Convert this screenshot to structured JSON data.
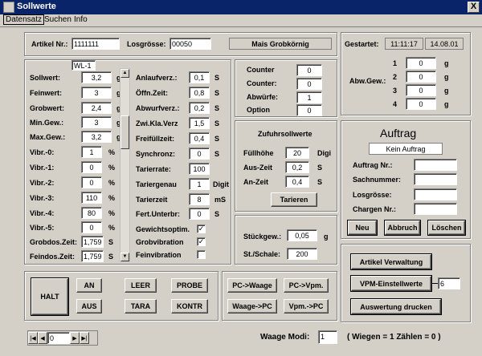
{
  "window": {
    "title": "Sollwerte",
    "close": "X"
  },
  "menu": [
    "Datensatz",
    "Suchen",
    "Info"
  ],
  "header": {
    "artikel_label": "Artikel Nr.:",
    "artikel_value": "1111111",
    "losgroesse_label": "Losgrösse:",
    "losgroesse_value": "00050",
    "product_name": "Mais Grobkörnig"
  },
  "gestartet": {
    "label": "Gestartet:",
    "time": "11:11:17",
    "date": "14.08.01"
  },
  "ausgew": {
    "label": "Abw.Gew.:",
    "rows": [
      {
        "n": "1",
        "v": "0",
        "u": "g"
      },
      {
        "n": "2",
        "v": "0",
        "u": "g"
      },
      {
        "n": "3",
        "v": "0",
        "u": "g"
      },
      {
        "n": "4",
        "v": "0",
        "u": "g"
      }
    ]
  },
  "sollwerte": {
    "tag": "WL-1",
    "left_rows": [
      {
        "label": "Sollwert:",
        "value": "3,2",
        "unit": "g"
      },
      {
        "label": "Feinwert:",
        "value": "3",
        "unit": "g"
      },
      {
        "label": "Grobwert:",
        "value": "2,4",
        "unit": "g"
      },
      {
        "label": "Min.Gew.:",
        "value": "3",
        "unit": "g"
      },
      {
        "label": "Max.Gew.:",
        "value": "3,2",
        "unit": "g"
      },
      {
        "label": "Vibr.-0:",
        "value": "1",
        "unit": "%"
      },
      {
        "label": "Vibr.-1:",
        "value": "0",
        "unit": "%"
      },
      {
        "label": "Vibr.-2:",
        "value": "0",
        "unit": "%"
      },
      {
        "label": "Vibr.-3:",
        "value": "110",
        "unit": "%"
      },
      {
        "label": "Vibr.-4:",
        "value": "80",
        "unit": "%"
      },
      {
        "label": "Vibr.-5:",
        "value": "0",
        "unit": "%"
      },
      {
        "label": "Grobdos.Zeit:",
        "value": "1,759",
        "unit": "S"
      },
      {
        "label": "Feindos.Zeit:",
        "value": "1,759",
        "unit": "S"
      }
    ],
    "right_rows": [
      {
        "label": "Anlaufverz.:",
        "value": "0,1",
        "unit": "S"
      },
      {
        "label": "Öffn.Zeit:",
        "value": "0,8",
        "unit": "S"
      },
      {
        "label": "Abwurfverz.:",
        "value": "0,2",
        "unit": "S"
      },
      {
        "label": "Zwi.Kla.Verz",
        "value": "1,5",
        "unit": "S"
      },
      {
        "label": "Freifüllzeit:",
        "value": "0,4",
        "unit": "S"
      },
      {
        "label": "Synchronz:",
        "value": "0",
        "unit": "S"
      },
      {
        "label": "Tarierrate:",
        "value": "100",
        "unit": ""
      },
      {
        "label": "Tariergenau",
        "value": "1",
        "unit": "Digit"
      },
      {
        "label": "Tarierzeit",
        "value": "8",
        "unit": "mS"
      },
      {
        "label": "Fert.Unterbr:",
        "value": "0",
        "unit": "S"
      }
    ],
    "checks": [
      {
        "label": "Gewichtsoptim.",
        "checked": "✓"
      },
      {
        "label": "Grobvibration",
        "checked": "✓"
      },
      {
        "label": "Feinvibration",
        "checked": ""
      }
    ]
  },
  "counter": {
    "rows": [
      {
        "label": "Counter",
        "value": "0"
      },
      {
        "label": "Counter:",
        "value": "0"
      },
      {
        "label": "Abwürfe:",
        "value": "1"
      },
      {
        "label": "Option",
        "value": "0"
      }
    ]
  },
  "zufuhr": {
    "title": "Zufuhrsollwerte",
    "rows": [
      {
        "label": "Füllhöhe",
        "value": "20",
        "unit": "Digi"
      },
      {
        "label": "Aus-Zeit",
        "value": "0,2",
        "unit": "S"
      },
      {
        "label": "An-Zeit",
        "value": "0,4",
        "unit": "S"
      }
    ],
    "tarieren": "Tarieren"
  },
  "stueck": {
    "rows": [
      {
        "label": "Stückgew.:",
        "value": "0,05",
        "unit": "g"
      },
      {
        "label": "St./Schale:",
        "value": "200",
        "unit": ""
      }
    ]
  },
  "auftrag": {
    "title": "Auftrag",
    "status": "Kein Auftrag",
    "fields": [
      "Auftrag Nr.:",
      "Sachnummer:",
      "Losgrösse:",
      "Chargen Nr.:"
    ],
    "buttons": [
      "Neu",
      "Abbruch",
      "Löschen"
    ]
  },
  "right_bottom": {
    "artikel_verwaltung": "Artikel Verwaltung",
    "vpm_einstellwerte": "VPM-Einstellwerte",
    "vpm_value": "6",
    "auswertung": "Auswertung drucken"
  },
  "controls": {
    "halt": "HALT",
    "grid": [
      "AN",
      "LEER",
      "PROBE",
      "AUS",
      "TARA",
      "KONTR"
    ]
  },
  "transfer": [
    "PC->Waage",
    "PC->Vpm.",
    "Waage->PC",
    "Vpm.->PC"
  ],
  "footer": {
    "nav_value": "0",
    "waage_modi_label": "Waage Modi:",
    "waage_modi_value": "1",
    "hint": "( Wiegen = 1  Zählen = 0 )"
  }
}
